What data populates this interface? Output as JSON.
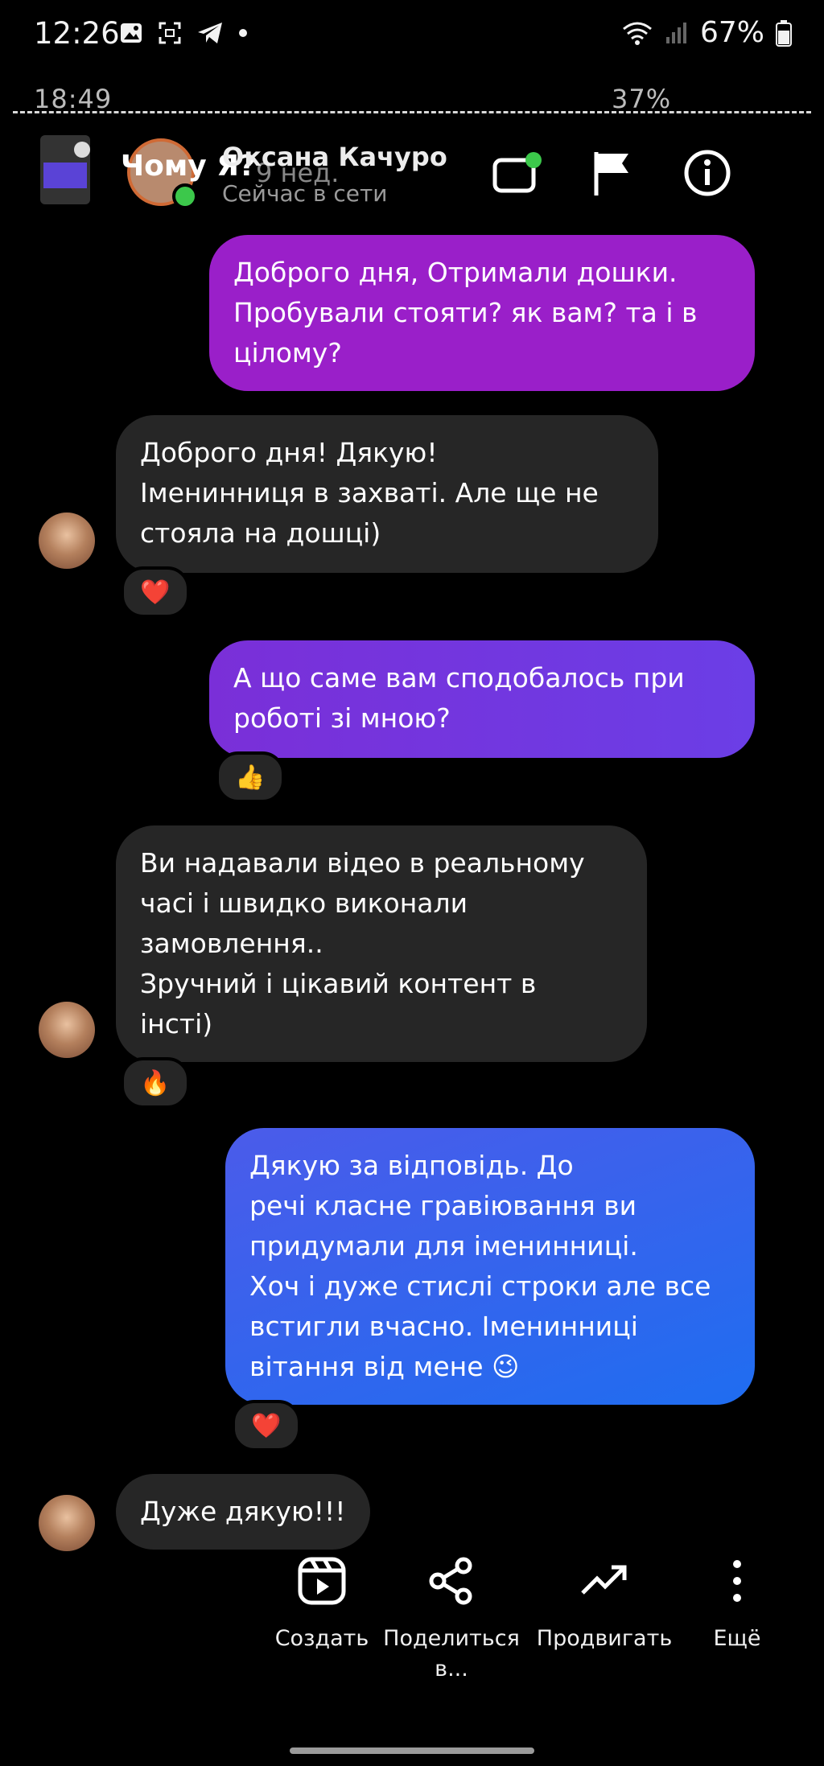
{
  "status_bar": {
    "time": "12:26",
    "battery": "67%",
    "icons": [
      "gallery-icon",
      "screenshot-icon",
      "telegram-icon",
      "dot-icon",
      "wifi-icon",
      "signal-icon",
      "battery-icon"
    ]
  },
  "inner_status": {
    "time": "18:49",
    "battery": "37%"
  },
  "header": {
    "overlay_title": "Чому Я?",
    "ago": "9 нед.",
    "name": "Оксана Качуро",
    "status": "Сейчас в сети",
    "icons": [
      "video-call-icon",
      "flag-icon",
      "info-icon"
    ]
  },
  "messages": [
    {
      "side": "out",
      "text": "Доброго дня, Отримали дошки.\nПробували стояти? як вам? та і в\nцілому?"
    },
    {
      "side": "in",
      "text": "Доброго дня! Дякую!\nІменинниця в захваті. Але ще не\nстояла на дошці)",
      "reaction": "❤️"
    },
    {
      "side": "out",
      "text": "А що саме вам сподобалось при\nроботі зі мною?",
      "reaction": "👍"
    },
    {
      "side": "in",
      "text": "Ви надавали відео в реальному\nчасі і швидко виконали\nзамовлення..\nЗручний і цікавий контент в\nінсті)",
      "reaction": "🔥"
    },
    {
      "side": "out",
      "text": "Дякую за відповідь. До\nречі класне гравіювання ви\nпридумали для іменинниці.\nХоч і дуже стислі строки але все\nвстигли вчасно. Іменинниці\nвітання від мене 😉",
      "reaction": "❤️"
    },
    {
      "side": "in",
      "text": "Дуже дякую!!!"
    }
  ],
  "actions": [
    {
      "label": "Создать",
      "icon": "reel-create-icon"
    },
    {
      "label": "Поделиться\nв...",
      "icon": "share-icon"
    },
    {
      "label": "Продвигать",
      "icon": "trending-icon"
    },
    {
      "label": "Ещё",
      "icon": "more-vertical-icon"
    }
  ]
}
